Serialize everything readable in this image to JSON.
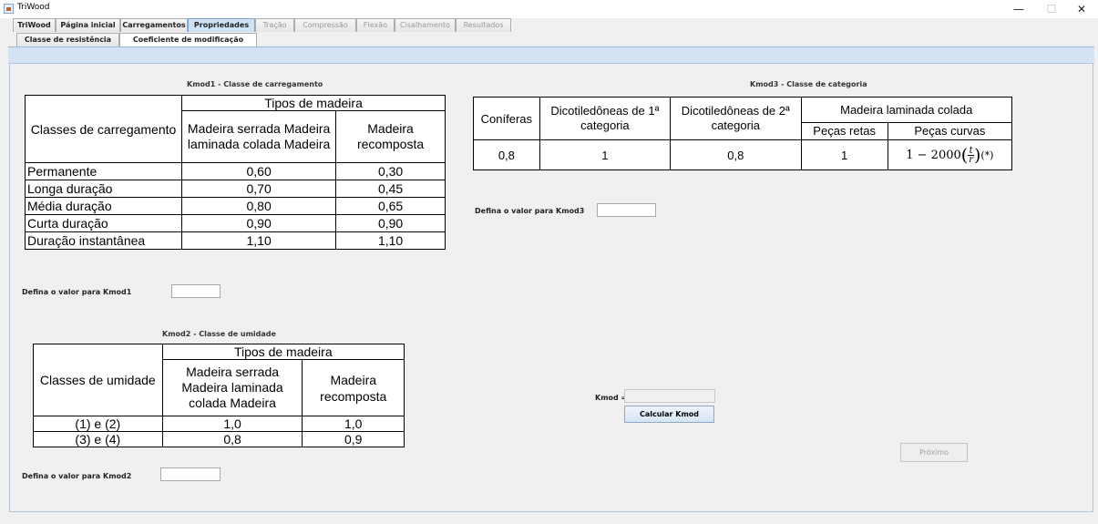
{
  "window": {
    "title": "TriWood",
    "buttons": {
      "minimize": "—",
      "maximize": "☐",
      "close": "✕"
    }
  },
  "main_tabs": [
    {
      "label": "TriWood",
      "state": "enabled"
    },
    {
      "label": "Página inicial",
      "state": "enabled"
    },
    {
      "label": "Carregamentos",
      "state": "enabled"
    },
    {
      "label": "Propriedades",
      "state": "selected"
    },
    {
      "label": "Tração",
      "state": "disabled"
    },
    {
      "label": "Compressão",
      "state": "disabled"
    },
    {
      "label": "Flexão",
      "state": "disabled"
    },
    {
      "label": "Cisalhamento",
      "state": "disabled"
    },
    {
      "label": "Resultados",
      "state": "disabled"
    }
  ],
  "sub_tabs": [
    {
      "label": "Classe de resistência",
      "state": "enabled"
    },
    {
      "label": "Coeficiente de modificação",
      "state": "selected"
    }
  ],
  "kmod1": {
    "caption": "Kmod1 - Classe de carregamento",
    "header_col1": "Classes de carregamento",
    "header_group": "Tipos de madeira",
    "header_col2": "Madeira serrada Madeira laminada colada Madeira",
    "header_col3": "Madeira recomposta",
    "rows": [
      {
        "label": "Permanente",
        "c1": "0,60",
        "c2": "0,30"
      },
      {
        "label": "Longa duração",
        "c1": "0,70",
        "c2": "0,45"
      },
      {
        "label": "Média duração",
        "c1": "0,80",
        "c2": "0,65"
      },
      {
        "label": "Curta duração",
        "c1": "0,90",
        "c2": "0,90"
      },
      {
        "label": "Duração instantânea",
        "c1": "1,10",
        "c2": "1,10"
      }
    ],
    "input_label": "Defina o valor para Kmod1",
    "input_value": ""
  },
  "kmod2": {
    "caption": "Kmod2 - Classe de umidade",
    "header_col1": "Classes de umidade",
    "header_group": "Tipos de madeira",
    "header_col2": "Madeira serrada Madeira laminada colada Madeira",
    "header_col3": "Madeira recomposta",
    "rows": [
      {
        "label": "(1) e (2)",
        "c1": "1,0",
        "c2": "1,0"
      },
      {
        "label": "(3) e (4)",
        "c1": "0,8",
        "c2": "0,9"
      }
    ],
    "input_label": "Defina o valor para Kmod2",
    "input_value": ""
  },
  "kmod3": {
    "caption": "Kmod3 - Classe de categoria",
    "col_coniferas": "Coníferas",
    "col_dicot1": "Dicotiledôneas de 1ª categoria",
    "col_dicot2": "Dicotiledôneas de 2ª categoria",
    "col_mlc": "Madeira laminada colada",
    "col_retas": "Peças retas",
    "col_curvas": "Peças curvas",
    "values": {
      "coniferas": "0,8",
      "dicot1": "1",
      "dicot2": "0,8",
      "retas": "1",
      "curvas_prefix": "1 − 2000",
      "curvas_num": "t",
      "curvas_den": "r",
      "curvas_suffix": "(*)"
    },
    "input_label": "Defina o valor para Kmod3",
    "input_value": ""
  },
  "result": {
    "label": "Kmod =",
    "value": "",
    "calc_button": "Calcular Kmod",
    "next_button": "Próximo"
  }
}
